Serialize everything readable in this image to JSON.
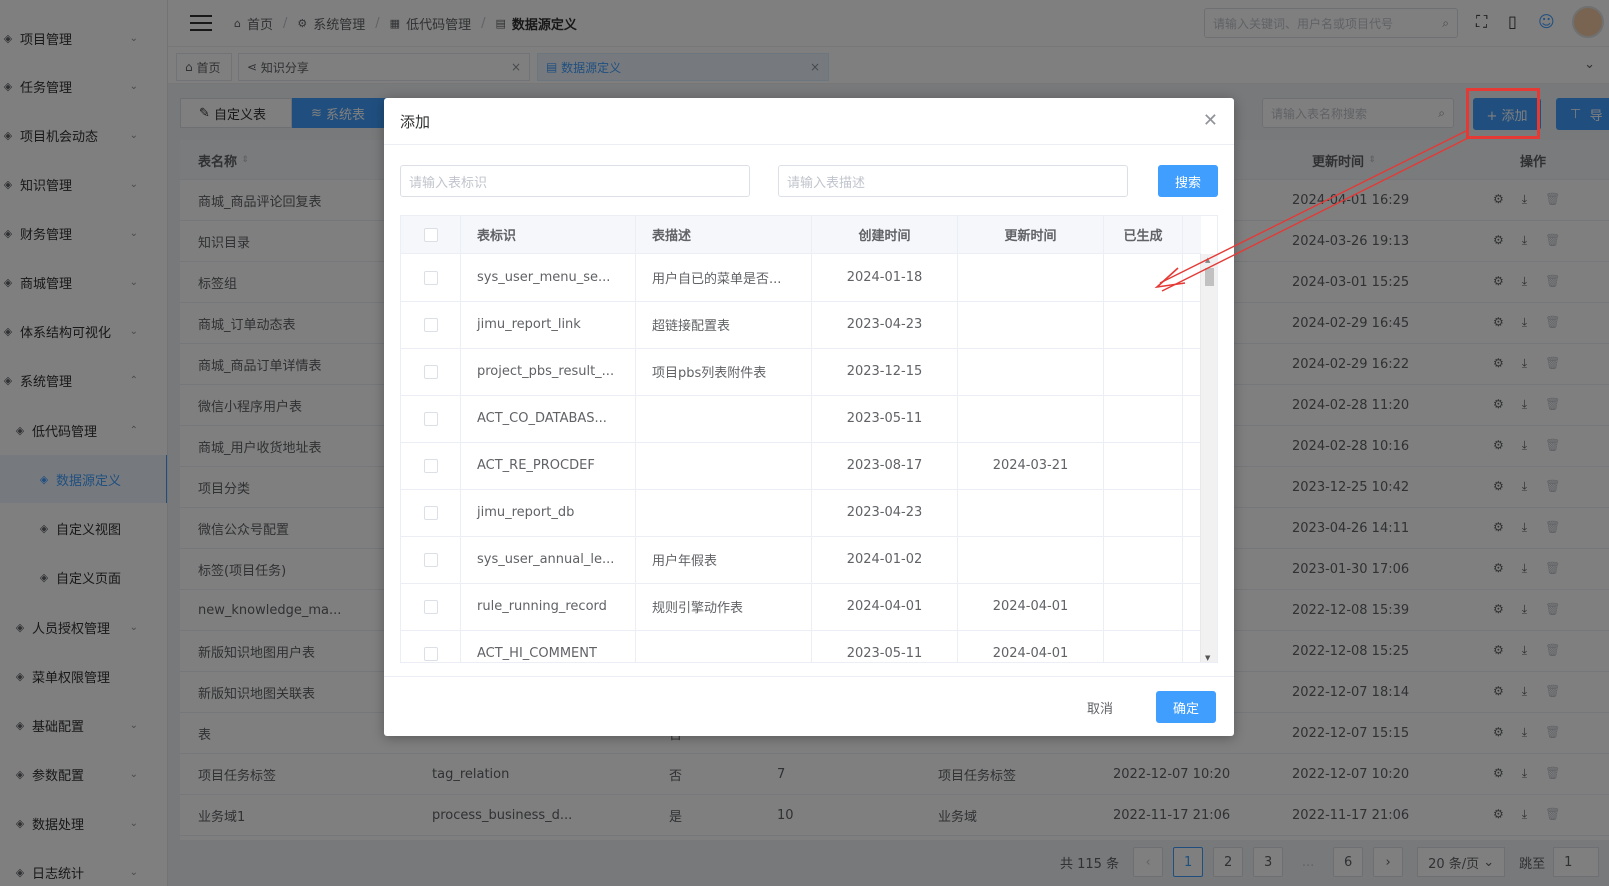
{
  "sidebar": {
    "items": [
      {
        "label": "项目管理",
        "icon": "layers-icon",
        "chevron": "⌄"
      },
      {
        "label": "任务管理",
        "icon": "task-icon",
        "chevron": "⌄"
      },
      {
        "label": "项目机会动态",
        "icon": "opportunity-icon",
        "chevron": "⌄"
      },
      {
        "label": "知识管理",
        "icon": "knowledge-icon",
        "chevron": "⌄"
      },
      {
        "label": "财务管理",
        "icon": "finance-icon",
        "chevron": "⌄"
      },
      {
        "label": "商城管理",
        "icon": "shop-icon",
        "chevron": "⌄"
      },
      {
        "label": "体系结构可视化",
        "icon": "structure-icon",
        "chevron": "⌄"
      },
      {
        "label": "系统管理",
        "icon": "system-icon",
        "chevron": "⌃"
      },
      {
        "label": "低代码管理",
        "icon": "grid-icon",
        "chevron": "⌃"
      },
      {
        "label": "数据源定义",
        "icon": "datasource-icon",
        "chevron": ""
      },
      {
        "label": "自定义视图",
        "icon": "view-icon",
        "chevron": ""
      },
      {
        "label": "自定义页面",
        "icon": "page-icon",
        "chevron": ""
      },
      {
        "label": "人员授权管理",
        "icon": "user-icon",
        "chevron": "⌄"
      },
      {
        "label": "菜单权限管理",
        "icon": "menu-grid-icon",
        "chevron": ""
      },
      {
        "label": "基础配置",
        "icon": "cube-icon",
        "chevron": "⌄"
      },
      {
        "label": "参数配置",
        "icon": "filter-icon",
        "chevron": "⌄"
      },
      {
        "label": "数据处理",
        "icon": "filter-icon",
        "chevron": "⌄"
      },
      {
        "label": "日志统计",
        "icon": "filter-icon",
        "chevron": "⌄"
      }
    ]
  },
  "header": {
    "breadcrumbs": [
      "首页",
      "系统管理",
      "低代码管理",
      "数据源定义"
    ],
    "search_placeholder": "请输入关键词、用户名或项目代号"
  },
  "tabs": [
    {
      "label": "首页"
    },
    {
      "label": "知识分享"
    },
    {
      "label": "数据源定义"
    }
  ],
  "toolbar": {
    "seg_custom": "自定义表",
    "seg_system": "系统表",
    "table_search_placeholder": "请输入表名称搜索",
    "add_label": "+ 添加",
    "export_label": "导"
  },
  "main_table": {
    "headers": {
      "name": "表名称",
      "updated": "更新时间",
      "ops": "操作"
    },
    "rows": [
      {
        "name": "商城_商品评论回复表",
        "c2": "",
        "c3": "",
        "c4": "",
        "c5": "",
        "c6": "",
        "updated": "2024-04-01 16:29"
      },
      {
        "name": "知识目录",
        "c2": "",
        "c3": "",
        "c4": "",
        "c5": "",
        "c6": "",
        "updated": "2024-03-26 19:13"
      },
      {
        "name": "标签组",
        "c2": "",
        "c3": "",
        "c4": "",
        "c5": "",
        "c6": "",
        "updated": "2024-03-01 15:25"
      },
      {
        "name": "商城_订单动态表",
        "c2": "",
        "c3": "",
        "c4": "",
        "c5": "",
        "c6": "",
        "updated": "2024-02-29 16:45"
      },
      {
        "name": "商城_商品订单详情表",
        "c2": "",
        "c3": "",
        "c4": "",
        "c5": "",
        "c6": "",
        "updated": "2024-02-29 16:22"
      },
      {
        "name": "微信小程序用户表",
        "c2": "",
        "c3": "",
        "c4": "",
        "c5": "",
        "c6": "",
        "updated": "2024-02-28 11:20"
      },
      {
        "name": "商城_用户收货地址表",
        "c2": "",
        "c3": "",
        "c4": "",
        "c5": "",
        "c6": "",
        "updated": "2024-02-28 10:16"
      },
      {
        "name": "项目分类",
        "c2": "",
        "c3": "",
        "c4": "",
        "c5": "",
        "c6": "",
        "updated": "2023-12-25 10:42"
      },
      {
        "name": "微信公众号配置",
        "c2": "",
        "c3": "",
        "c4": "",
        "c5": "",
        "c6": "",
        "updated": "2023-04-26 14:11"
      },
      {
        "name": "标签(项目任务)",
        "c2": "",
        "c3": "",
        "c4": "",
        "c5": "",
        "c6": "",
        "updated": "2023-01-30 17:06"
      },
      {
        "name": "new_knowledge_ma...",
        "c2": "",
        "c3": "",
        "c4": "",
        "c5": "",
        "c6": "",
        "updated": "2022-12-08 15:39"
      },
      {
        "name": "新版知识地图用户表",
        "c2": "",
        "c3": "",
        "c4": "",
        "c5": "",
        "c6": "",
        "updated": "2022-12-08 15:25"
      },
      {
        "name": "新版知识地图关联表",
        "c2": "",
        "c3": "",
        "c4": "",
        "c5": "",
        "c6": "",
        "updated": "2022-12-07 18:14"
      },
      {
        "name": "表",
        "c2": "",
        "c3": "否",
        "c4": "",
        "c5": "",
        "c6": "",
        "updated": "2022-12-07 15:15"
      },
      {
        "name": "项目任务标签",
        "c2": "tag_relation",
        "c3": "否",
        "c4": "7",
        "c5": "项目任务标签",
        "c6": "2022-12-07 10:20",
        "updated": "2022-12-07 10:20"
      },
      {
        "name": "业务域1",
        "c2": "process_business_d...",
        "c3": "是",
        "c4": "10",
        "c5": "业务域",
        "c6": "2022-11-17 21:06",
        "updated": "2022-11-17 21:06"
      }
    ]
  },
  "pager": {
    "total": "共 115 条",
    "pages": [
      "1",
      "2",
      "3",
      "...",
      "6"
    ],
    "size": "20 条/页",
    "jump_label": "跳至",
    "jump_value": "1"
  },
  "dialog": {
    "title": "添加",
    "input_id_placeholder": "请输入表标识",
    "input_desc_placeholder": "请输入表描述",
    "search_label": "搜索",
    "headers": {
      "id": "表标识",
      "desc": "表描述",
      "created": "创建时间",
      "updated": "更新时间",
      "generated": "已生成"
    },
    "rows": [
      {
        "id": "sys_user_menu_se...",
        "desc": "用户自已的菜单是否...",
        "created": "2024-01-18",
        "updated": "",
        "generated": ""
      },
      {
        "id": "jimu_report_link",
        "desc": "超链接配置表",
        "created": "2023-04-23",
        "updated": "",
        "generated": ""
      },
      {
        "id": "project_pbs_result_...",
        "desc": "项目pbs列表附件表",
        "created": "2023-12-15",
        "updated": "",
        "generated": ""
      },
      {
        "id": "ACT_CO_DATABAS...",
        "desc": "",
        "created": "2023-05-11",
        "updated": "",
        "generated": ""
      },
      {
        "id": "ACT_RE_PROCDEF",
        "desc": "",
        "created": "2023-08-17",
        "updated": "2024-03-21",
        "generated": ""
      },
      {
        "id": "jimu_report_db",
        "desc": "",
        "created": "2023-04-23",
        "updated": "",
        "generated": ""
      },
      {
        "id": "sys_user_annual_le...",
        "desc": "用户年假表",
        "created": "2024-01-02",
        "updated": "",
        "generated": ""
      },
      {
        "id": "rule_running_record",
        "desc": "规则引擎动作表",
        "created": "2024-04-01",
        "updated": "2024-04-01",
        "generated": ""
      },
      {
        "id": "ACT_HI_COMMENT",
        "desc": "",
        "created": "2023-05-11",
        "updated": "2024-04-01",
        "generated": ""
      }
    ],
    "cancel_label": "取消",
    "ok_label": "确定"
  },
  "colors": {
    "primary": "#409eff",
    "annotation": "#e53935"
  }
}
